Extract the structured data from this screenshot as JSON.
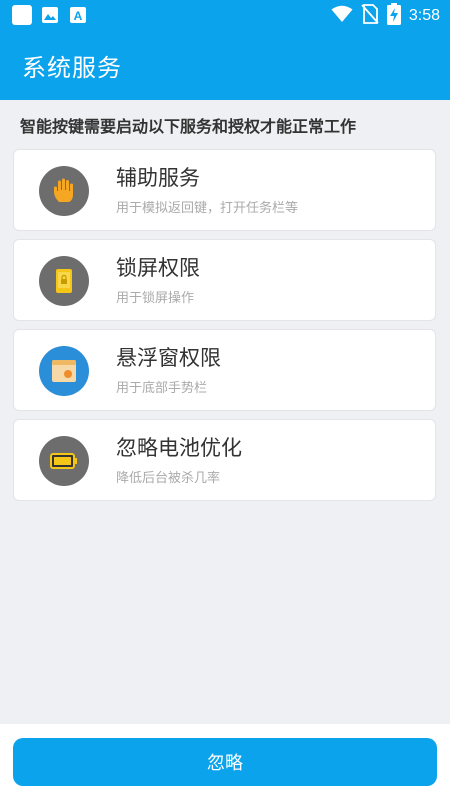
{
  "status_bar": {
    "time": "3:58",
    "notification_icons": [
      "app-square-icon",
      "image-icon",
      "a-letter-icon"
    ],
    "a_icon_letter": "A",
    "system_icons": [
      "wifi-icon",
      "no-sim-icon",
      "battery-charging-icon"
    ]
  },
  "header": {
    "title": "系统服务"
  },
  "intro": {
    "text": "智能按键需要启动以下服务和授权才能正常工作"
  },
  "items": [
    {
      "title": "辅助服务",
      "subtitle": "用于模拟返回键，打开任务栏等",
      "icon": "hand-icon",
      "icon_bg": "#6d6d6d"
    },
    {
      "title": "锁屏权限",
      "subtitle": "用于锁屏操作",
      "icon": "lock-phone-icon",
      "icon_bg": "#6d6d6d"
    },
    {
      "title": "悬浮窗权限",
      "subtitle": "用于底部手势栏",
      "icon": "floating-window-icon",
      "icon_bg": "#2b8ed8"
    },
    {
      "title": "忽略电池优化",
      "subtitle": "降低后台被杀几率",
      "icon": "battery-icon",
      "icon_bg": "#6d6d6d"
    }
  ],
  "footer": {
    "ignore_label": "忽略"
  },
  "colors": {
    "primary": "#0aa3ec",
    "background": "#eef0f3"
  }
}
